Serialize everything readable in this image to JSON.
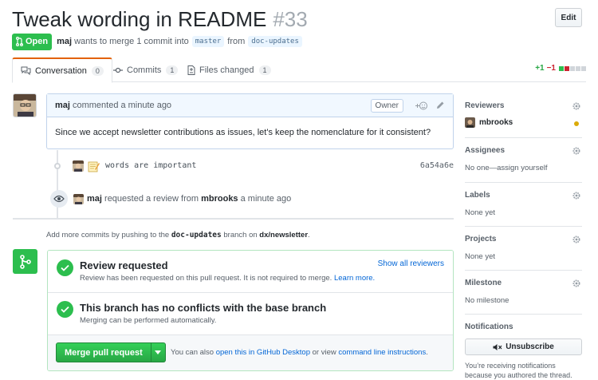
{
  "pull_request": {
    "title": "Tweak wording in README",
    "number": "#33",
    "edit_label": "Edit",
    "state": "Open",
    "author": "maj",
    "merge_text": "wants to merge 1 commit into",
    "base_branch": "master",
    "from_text": "from",
    "head_branch": "doc-updates"
  },
  "tabs": [
    {
      "label": "Conversation",
      "count": "0",
      "icon": "comment-discussion-icon",
      "selected": true
    },
    {
      "label": "Commits",
      "count": "1",
      "icon": "git-commit-icon"
    },
    {
      "label": "Files changed",
      "count": "1",
      "icon": "file-diff-icon"
    }
  ],
  "diffstat": {
    "additions": "+1",
    "deletions": "−1",
    "blocks": [
      "green",
      "red",
      "gray",
      "gray",
      "gray"
    ]
  },
  "comment": {
    "author": "maj",
    "action": "commented",
    "time": "a minute ago",
    "role_label": "Owner",
    "body": "Since we accept newsletter contributions as issues, let's keep the nomenclature for it consistent?"
  },
  "commit": {
    "message": "words are important",
    "sha": "6a54a6e",
    "emoji_icon": "memo-icon"
  },
  "review_event": {
    "actor": "maj",
    "text": "requested a review from",
    "reviewer": "mbrooks",
    "time": "a minute ago"
  },
  "push_hint": {
    "prefix": "Add more commits by pushing to the",
    "branch": "doc-updates",
    "middle": "branch on",
    "repo": "dx/newsletter",
    "suffix": "."
  },
  "merge_box": {
    "review": {
      "title": "Review requested",
      "description": "Review has been requested on this pull request. It is not required to merge.",
      "learn_more": "Learn more.",
      "show_all": "Show all reviewers"
    },
    "conflicts": {
      "title": "This branch has no conflicts with the base branch",
      "description": "Merging can be performed automatically."
    },
    "merge_button": "Merge pull request",
    "alt_prefix": "You can also",
    "alt_link1": "open this in GitHub Desktop",
    "alt_middle": "or view",
    "alt_link2": "command line instructions",
    "alt_suffix": "."
  },
  "sidebar": {
    "reviewers": {
      "heading": "Reviewers",
      "name": "mbrooks",
      "status_color": "#dbab09"
    },
    "assignees": {
      "heading": "Assignees",
      "value": "No one—assign yourself"
    },
    "labels": {
      "heading": "Labels",
      "value": "None yet"
    },
    "projects": {
      "heading": "Projects",
      "value": "None yet"
    },
    "milestone": {
      "heading": "Milestone",
      "value": "No milestone"
    },
    "notifications": {
      "heading": "Notifications",
      "button": "Unsubscribe",
      "note_line1": "You’re receiving notifications",
      "note_line2": "because you authored the thread."
    }
  },
  "colors": {
    "accent_green": "#2cbe4e",
    "link_blue": "#0366d6",
    "tab_orange": "#e36209"
  }
}
